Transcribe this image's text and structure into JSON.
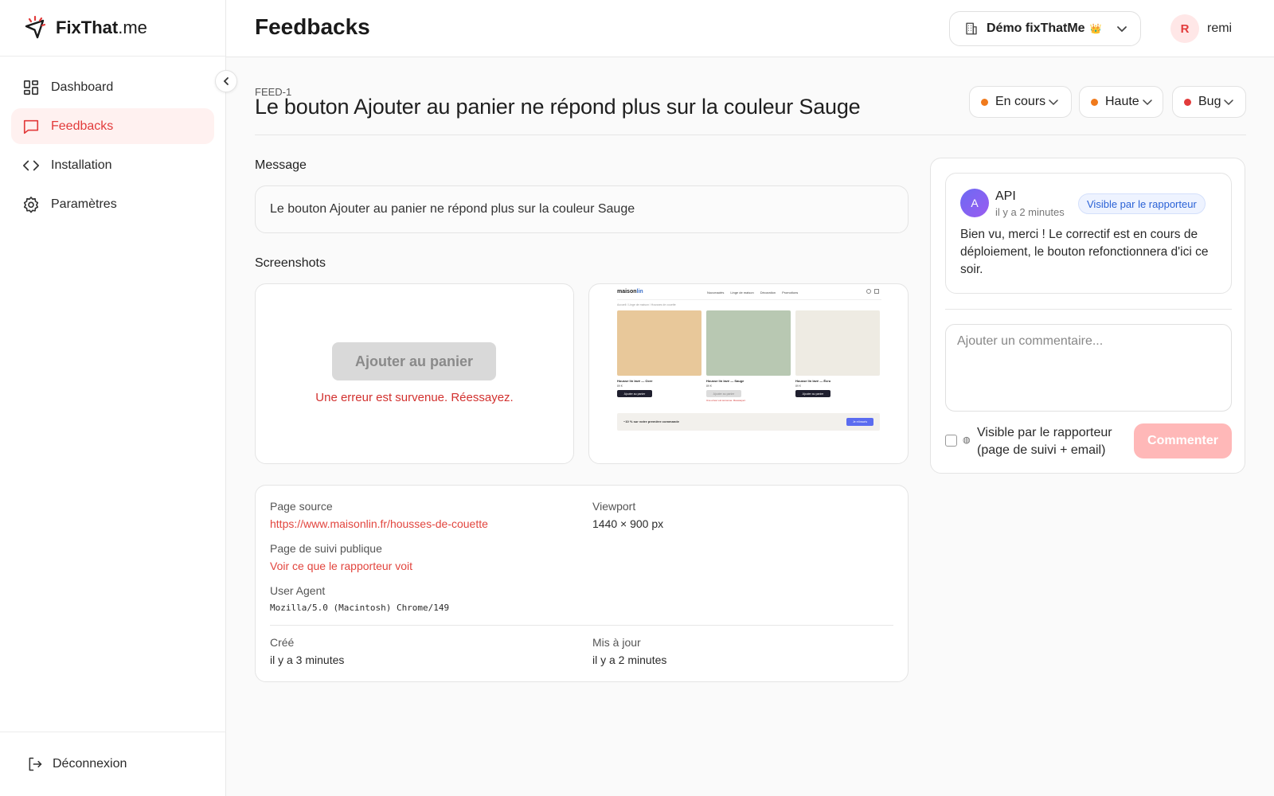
{
  "app": {
    "brand_bold": "FixThat",
    "brand_suffix": ".me"
  },
  "sidebar": {
    "items": [
      {
        "label": "Dashboard",
        "icon": "grid-icon"
      },
      {
        "label": "Feedbacks",
        "icon": "chat-bubble-icon",
        "active": true
      },
      {
        "label": "Installation",
        "icon": "code-icon"
      },
      {
        "label": "Paramètres",
        "icon": "gear-icon"
      }
    ],
    "logout_label": "Déconnexion"
  },
  "header": {
    "title": "Feedbacks",
    "org_name": "Démo fixThatMe",
    "org_badge": "👑",
    "user_initial": "R",
    "user_name": "remi"
  },
  "feedback": {
    "id": "FEED-1",
    "title": "Le bouton Ajouter au panier ne répond plus sur la couleur Sauge",
    "status": {
      "label": "En cours",
      "color": "#f07a1c"
    },
    "priority": {
      "label": "Haute",
      "color": "#f07a1c"
    },
    "type": {
      "label": "Bug",
      "color": "#e23b3b"
    },
    "message_label": "Message",
    "message": "Le bouton Ajouter au panier ne répond plus sur la couleur Sauge",
    "screenshots_label": "Screenshots"
  },
  "screenshot1": {
    "button_label": "Ajouter au panier",
    "error_text": "Une erreur est survenue. Réessayez."
  },
  "screenshot2": {
    "logo_main": "maison",
    "logo_accent": "lin",
    "nav": [
      "Nouveautés",
      "Linge de maison",
      "Décoration",
      "Promotions"
    ],
    "breadcrumb": "Accueil / Linge de maison / Housses de couette",
    "products": [
      {
        "name": "Housse lin lavé — Ocre",
        "price": "89 €",
        "button": "Ajouter au panier",
        "color": "#e8c89a",
        "disabled": false,
        "error": ""
      },
      {
        "name": "Housse lin lavé — Sauge",
        "price": "89 €",
        "button": "Ajouter au panier",
        "color": "#b8c8b2",
        "disabled": true,
        "error": "Une erreur est survenue. Réessayez."
      },
      {
        "name": "Housse lin lavé — Écru",
        "price": "89 €",
        "button": "Ajouter au panier",
        "color": "#eeebe3",
        "disabled": false,
        "error": ""
      }
    ],
    "promo_text": "−10 % sur votre première commande",
    "promo_cta": "Je m'inscris"
  },
  "meta": {
    "page_source_label": "Page source",
    "page_source_url": "https://www.maisonlin.fr/housses-de-couette",
    "viewport_label": "Viewport",
    "viewport_value": "1440 × 900 px",
    "tracking_label": "Page de suivi publique",
    "tracking_link": "Voir ce que le rapporteur voit",
    "user_agent_label": "User Agent",
    "user_agent_value": "Mozilla/5.0 (Macintosh) Chrome/149",
    "created_label": "Créé",
    "created_value": "il y a 3 minutes",
    "updated_label": "Mis à jour",
    "updated_value": "il y a 2 minutes"
  },
  "comments": {
    "items": [
      {
        "initial": "A",
        "author": "API",
        "time": "il y a 2 minutes",
        "badge": "Visible par le rapporteur",
        "text": "Bien vu, merci ! Le correctif est en cours de déploiement, le bouton refonctionnera d'ici ce soir."
      }
    ],
    "input_placeholder": "Ajouter un commentaire...",
    "visibility_label": "Visible par le rapporteur (page de suivi + email)",
    "submit_label": "Commenter"
  }
}
